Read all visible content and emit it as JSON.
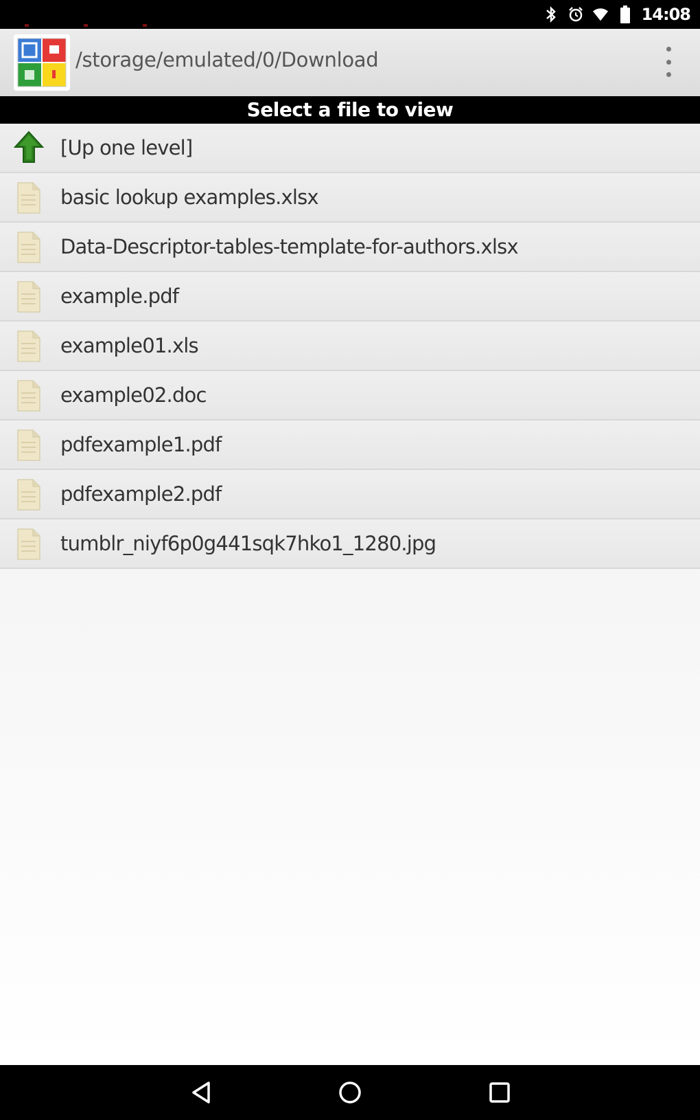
{
  "status_bar": {
    "time": "14:08",
    "icons": [
      "bluetooth-icon",
      "alarm-icon",
      "wifi-icon",
      "battery-icon"
    ]
  },
  "app_bar": {
    "path": "/storage/emulated/0/Download",
    "app_icon": "app-logo-icon",
    "overflow_icon": "more-vertical-icon"
  },
  "header": {
    "title": "Select a file to view"
  },
  "file_list": {
    "up_level": {
      "label": "[Up one level]",
      "icon": "up-arrow-icon"
    },
    "files": [
      {
        "label": "basic lookup examples.xlsx",
        "icon": "file-icon"
      },
      {
        "label": "Data-Descriptor-tables-template-for-authors.xlsx",
        "icon": "file-icon"
      },
      {
        "label": "example.pdf",
        "icon": "file-icon"
      },
      {
        "label": "example01.xls",
        "icon": "file-icon"
      },
      {
        "label": "example02.doc",
        "icon": "file-icon"
      },
      {
        "label": "pdfexample1.pdf",
        "icon": "file-icon"
      },
      {
        "label": "pdfexample2.pdf",
        "icon": "file-icon"
      },
      {
        "label": "tumblr_niyf6p0g441sqk7hko1_1280.jpg",
        "icon": "file-icon"
      }
    ]
  },
  "nav_bar": {
    "buttons": [
      "back-icon",
      "home-icon",
      "recents-icon"
    ]
  },
  "colors": {
    "status_bar": "#000000",
    "app_bar": "#e4e4e4",
    "header_bar": "#000000",
    "up_arrow": "#2e7d1e",
    "file_icon": "#efe6c8"
  }
}
